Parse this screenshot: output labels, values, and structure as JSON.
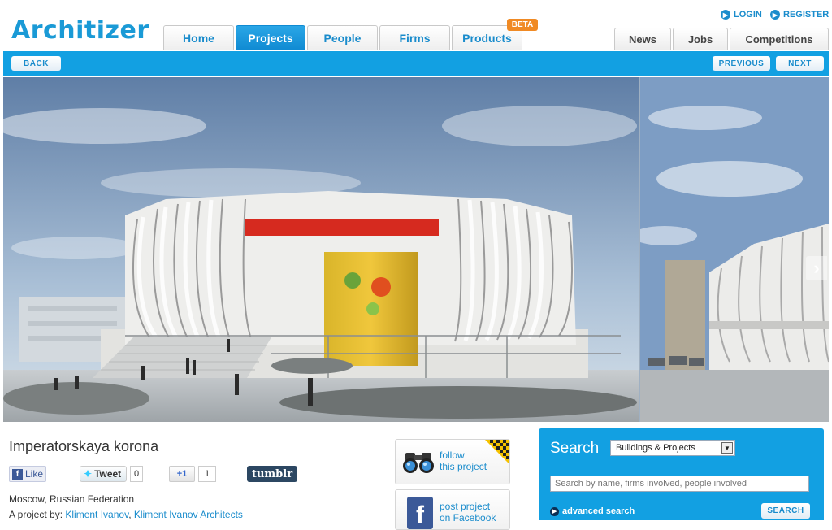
{
  "header": {
    "logo": "Architizer",
    "login": "LOGIN",
    "register": "REGISTER",
    "tabs": [
      {
        "label": "Home"
      },
      {
        "label": "Projects"
      },
      {
        "label": "People"
      },
      {
        "label": "Firms"
      },
      {
        "label": "Products"
      }
    ],
    "beta_badge": "BETA",
    "right_tabs": [
      {
        "label": "News"
      },
      {
        "label": "Jobs"
      },
      {
        "label": "Competitions"
      }
    ]
  },
  "navbar": {
    "back": "BACK",
    "previous": "PREVIOUS",
    "next": "NEXT"
  },
  "gallery": {
    "next_arrow": "›"
  },
  "project": {
    "title": "Imperatorskaya korona",
    "location": "Moscow, Russian Federation",
    "byline_prefix": "A project by: ",
    "byline_person": "Kliment Ivanov",
    "byline_sep": ", ",
    "byline_firm": "Kliment Ivanov Architects"
  },
  "social": {
    "like": "Like",
    "tweet": "Tweet",
    "tweet_count": "0",
    "gplus": "+1",
    "gplus_count": "1",
    "tumblr": "tumblr"
  },
  "actions": {
    "follow_line1": "follow",
    "follow_line2": "this project",
    "fb_line1": "post project",
    "fb_line2": "on Facebook"
  },
  "search": {
    "title": "Search",
    "category": "Buildings & Projects",
    "placeholder": "Search by name, firms involved, people involved",
    "advanced": "advanced search",
    "button": "SEARCH"
  },
  "colors": {
    "accent": "#12a0e2",
    "link": "#1a8ccc",
    "beta": "#f08a24"
  }
}
